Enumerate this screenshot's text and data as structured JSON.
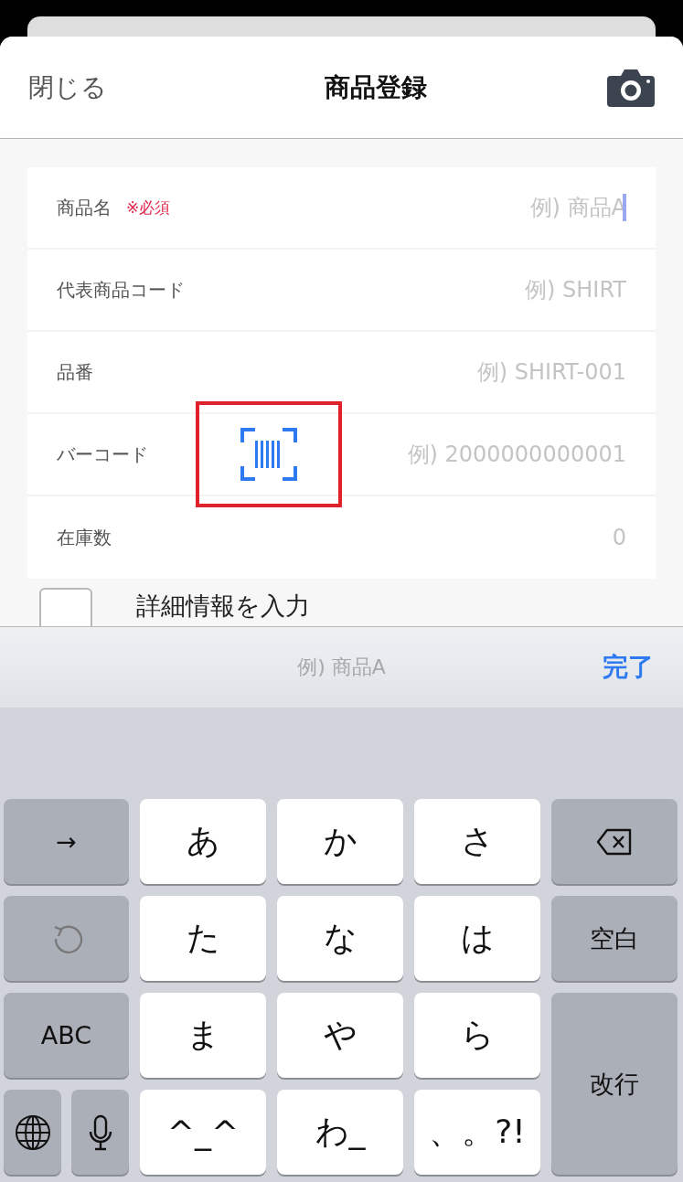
{
  "header": {
    "close": "閉じる",
    "title": "商品登録"
  },
  "fields": [
    {
      "kind": "text",
      "label": "商品名",
      "required": "※必須",
      "placeholder": "例) 商品A",
      "focused": true
    },
    {
      "kind": "text",
      "label": "代表商品コード",
      "placeholder": "例) SHIRT",
      "focused": false
    },
    {
      "kind": "text",
      "label": "品番",
      "placeholder": "例) SHIRT-001",
      "focused": false
    },
    {
      "kind": "barcode",
      "label": "バーコード",
      "placeholder": "例) 2000000000001",
      "focused": false
    },
    {
      "kind": "text",
      "label": "在庫数",
      "placeholder": "0",
      "focused": false
    }
  ],
  "detail": {
    "label": "詳細情報を入力",
    "checked": false
  },
  "accessory": {
    "preview": "例) 商品A",
    "done": "完了"
  },
  "keys": [
    {
      "kind": "func",
      "text": "→"
    },
    {
      "kind": "char",
      "text": "あ"
    },
    {
      "kind": "char",
      "text": "か"
    },
    {
      "kind": "char",
      "text": "さ"
    },
    {
      "kind": "delete"
    },
    {
      "kind": "undo"
    },
    {
      "kind": "char",
      "text": "た"
    },
    {
      "kind": "char",
      "text": "な"
    },
    {
      "kind": "char",
      "text": "は"
    },
    {
      "kind": "func",
      "text": "空白"
    },
    {
      "kind": "func",
      "text": "ABC"
    },
    {
      "kind": "char",
      "text": "ま"
    },
    {
      "kind": "char",
      "text": "や"
    },
    {
      "kind": "char",
      "text": "ら"
    },
    {
      "kind": "tall",
      "text": "改行"
    },
    {
      "kind": "globe"
    },
    {
      "kind": "mic"
    },
    {
      "kind": "char",
      "text": "^_^"
    },
    {
      "kind": "char",
      "text": "わ_"
    },
    {
      "kind": "char",
      "text": "、。?!"
    }
  ]
}
